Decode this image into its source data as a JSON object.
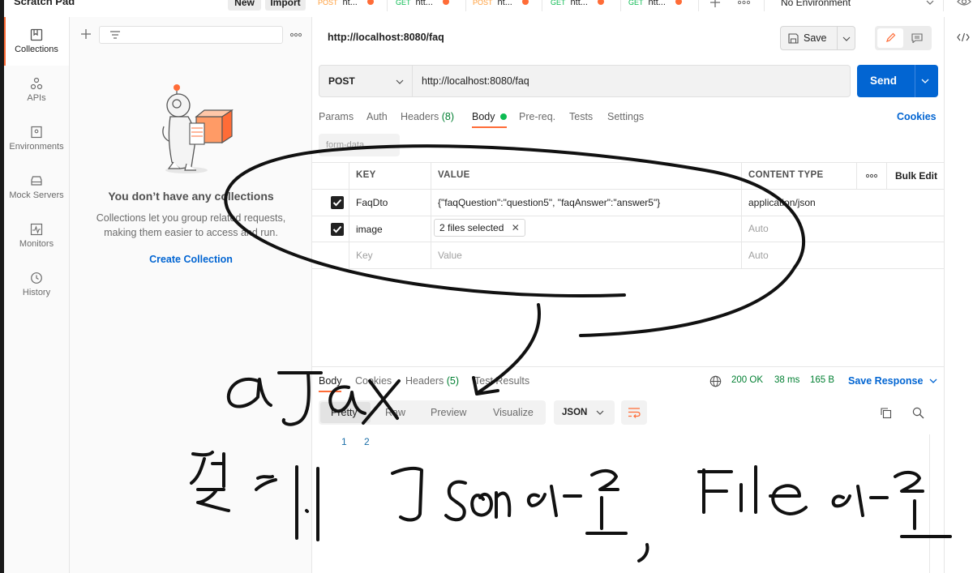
{
  "sidebar": {
    "title": "Scratch Pad",
    "new_label": "New",
    "import_label": "Import",
    "nav": [
      {
        "label": "Collections",
        "icon": "collections-icon"
      },
      {
        "label": "APIs",
        "icon": "apis-icon"
      },
      {
        "label": "Environments",
        "icon": "environments-icon"
      },
      {
        "label": "Mock Servers",
        "icon": "mock-servers-icon"
      },
      {
        "label": "Monitors",
        "icon": "monitors-icon"
      },
      {
        "label": "History",
        "icon": "history-icon"
      }
    ]
  },
  "collections": {
    "empty_title": "You don’t have any collections",
    "empty_desc": "Collections let you group related requests, making them easier to access and run.",
    "create_label": "Create Collection"
  },
  "tabs": [
    {
      "method": "POST",
      "label": "ht...",
      "method_color": "#ff9c37"
    },
    {
      "method": "GET",
      "label": "htt...",
      "method_color": "#0cbb52"
    },
    {
      "method": "POST",
      "label": "ht...",
      "method_color": "#ff9c37"
    },
    {
      "method": "GET",
      "label": "htt...",
      "method_color": "#0cbb52"
    },
    {
      "method": "GET",
      "label": "htt...",
      "method_color": "#0cbb52"
    }
  ],
  "environment": "No Environment",
  "request": {
    "title": "http://localhost:8080/faq",
    "save_label": "Save",
    "method": "POST",
    "url": "http://localhost:8080/faq",
    "send_label": "Send",
    "tabs": [
      "Params",
      "Auth",
      "Headers",
      "Body",
      "Pre-req.",
      "Tests",
      "Settings"
    ],
    "headers_count": "(8)",
    "cookies_label": "Cookies",
    "body_mode": "form-data"
  },
  "table": {
    "headers": {
      "key": "KEY",
      "value": "VALUE",
      "content_type": "CONTENT TYPE",
      "bulk_edit": "Bulk Edit"
    },
    "rows": [
      {
        "key": "FaqDto",
        "value": "{\"faqQuestion\":\"question5\", \"faqAnswer\":\"answer5\"}",
        "content_type": "application/json"
      },
      {
        "key": "image",
        "value": "2 files selected",
        "content_type": "Auto"
      }
    ],
    "placeholder": {
      "key": "Key",
      "value": "Value",
      "content_type": "Auto"
    }
  },
  "response": {
    "tabs": [
      "Body",
      "Cookies",
      "Headers",
      "Test Results"
    ],
    "headers_count": "(5)",
    "status": "200 OK",
    "time": "38 ms",
    "size": "165 B",
    "save_label": "Save Response",
    "views": [
      "Pretty",
      "Raw",
      "Preview",
      "Visualize"
    ],
    "format": "JSON",
    "line_numbers": [
      "1",
      "2"
    ]
  },
  "colors": {
    "accent": "#ff6c37",
    "link": "#0265d2",
    "status_ok": "#007f31"
  }
}
